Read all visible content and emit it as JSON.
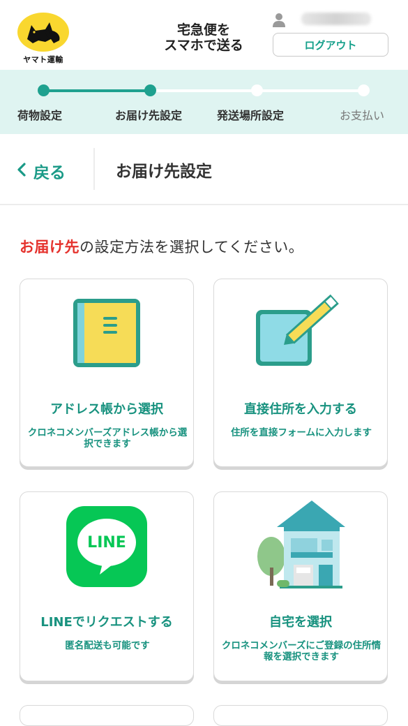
{
  "header": {
    "logo_text": "ヤマト運輸",
    "app_title_line1": "宅急便を",
    "app_title_line2": "スマホで送る",
    "logout_label": "ログアウト",
    "user_icon": "user-icon"
  },
  "progress": {
    "steps": [
      {
        "label": "荷物設定",
        "state": "done"
      },
      {
        "label": "お届け先設定",
        "state": "current"
      },
      {
        "label": "発送場所設定",
        "state": "todo"
      },
      {
        "label": "お支払い",
        "state": "todo"
      }
    ]
  },
  "subheader": {
    "back_label": "戻る",
    "back_icon": "chevron-left-icon",
    "title": "お届け先設定"
  },
  "main": {
    "instruction_emphasis": "お届け先",
    "instruction_rest": "の設定方法を選択してください。",
    "options": [
      {
        "icon": "address-book-icon",
        "title": "アドレス帳から選択",
        "desc": "クロネコメンバーズアドレス帳から選択できます"
      },
      {
        "icon": "pencil-form-icon",
        "title": "直接住所を入力する",
        "desc": "住所を直接フォームに入力します"
      },
      {
        "icon": "line-app-icon",
        "icon_text": "LINE",
        "title": "LINEでリクエストする",
        "desc": "匿名配送も可能です"
      },
      {
        "icon": "house-icon",
        "title": "自宅を選択",
        "desc": "クロネコメンバーズにご登録の住所情報を選択できます"
      }
    ]
  },
  "colors": {
    "accent": "#1fa18f",
    "progress_bg": "#dff4f1",
    "emphasis_red": "#e5322d",
    "logo_yellow": "#f9d72f",
    "line_green": "#06c755"
  }
}
